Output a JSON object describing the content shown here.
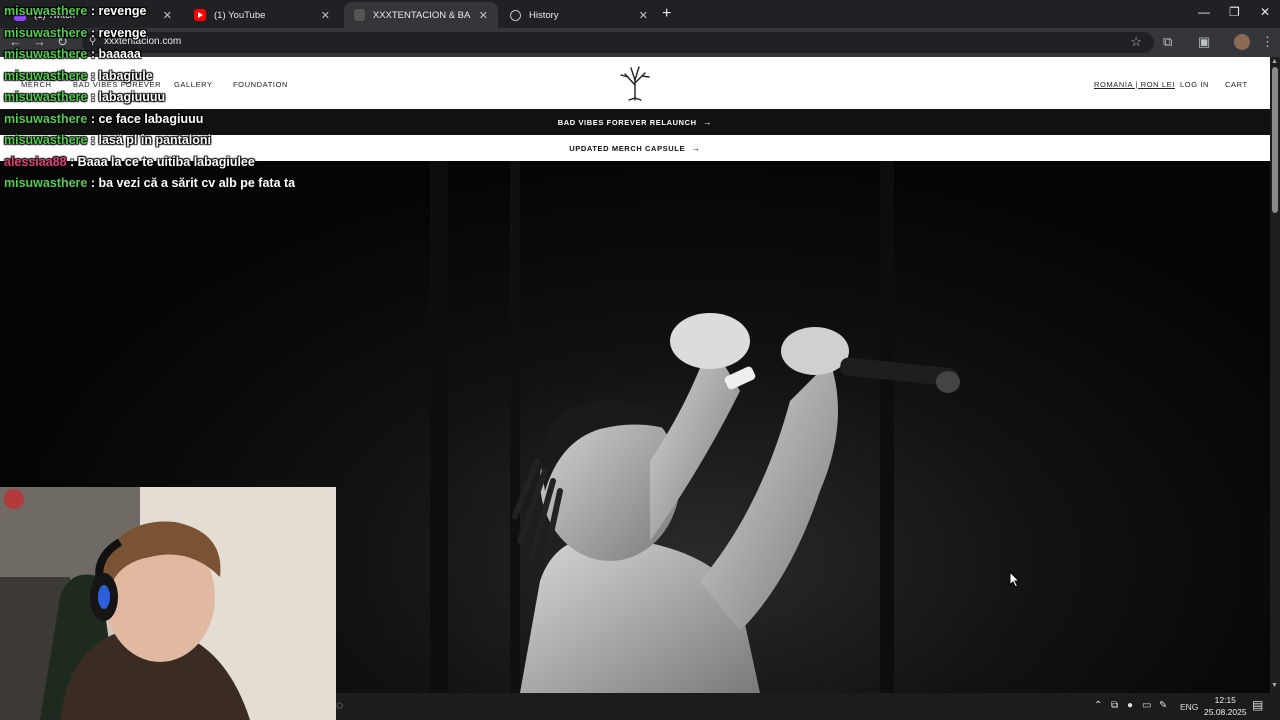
{
  "browser": {
    "tabs": [
      {
        "label": "(1) Twitch",
        "icon": "twitch-icon"
      },
      {
        "label": "(1) YouTube",
        "icon": "youtube-icon"
      },
      {
        "label": "XXXTENTACION & BAD VIBES FOREVER",
        "icon": "tree-logo-icon"
      },
      {
        "label": "History",
        "icon": "history-icon"
      }
    ],
    "url": "xxxtentacion.com"
  },
  "site": {
    "nav_left": [
      "MERCH",
      "BAD VIBES FOREVER",
      "GALLERY",
      "FOUNDATION"
    ],
    "region": "ROMANIA | RON LEI",
    "login": "LOG IN",
    "cart": "CART",
    "banner1": "BAD VIBES FOREVER RELAUNCH",
    "banner2": "UPDATED MERCH CAPSULE"
  },
  "chat": [
    {
      "user": "misuwasthere",
      "text": "revenge"
    },
    {
      "user": "misuwasthere",
      "text": "revenge"
    },
    {
      "user": "misuwasthere",
      "text": "baaaaa"
    },
    {
      "user": "misuwasthere",
      "text": "labagiule"
    },
    {
      "user": "misuwasthere",
      "text": "labagiuuuu"
    },
    {
      "user": "misuwasthere",
      "text": "ce face labagiuuu"
    },
    {
      "user": "misuwasthere",
      "text": "lasă pl în pantaloni"
    },
    {
      "user": "alessiaa88",
      "text": "Baaa la ce te uitiba labagiulee"
    },
    {
      "user": "misuwasthere",
      "text": "ba vezi că a sărit cv alb pe fata ta"
    }
  ],
  "taskbar": {
    "language": "ENG",
    "time": "12:15",
    "date": "25.08.2025"
  },
  "colors": {
    "chat_user": "#4fd04a",
    "chat_user_alt": "#e0407a",
    "tabstrip": "#202124",
    "toolbar": "#35363a"
  }
}
